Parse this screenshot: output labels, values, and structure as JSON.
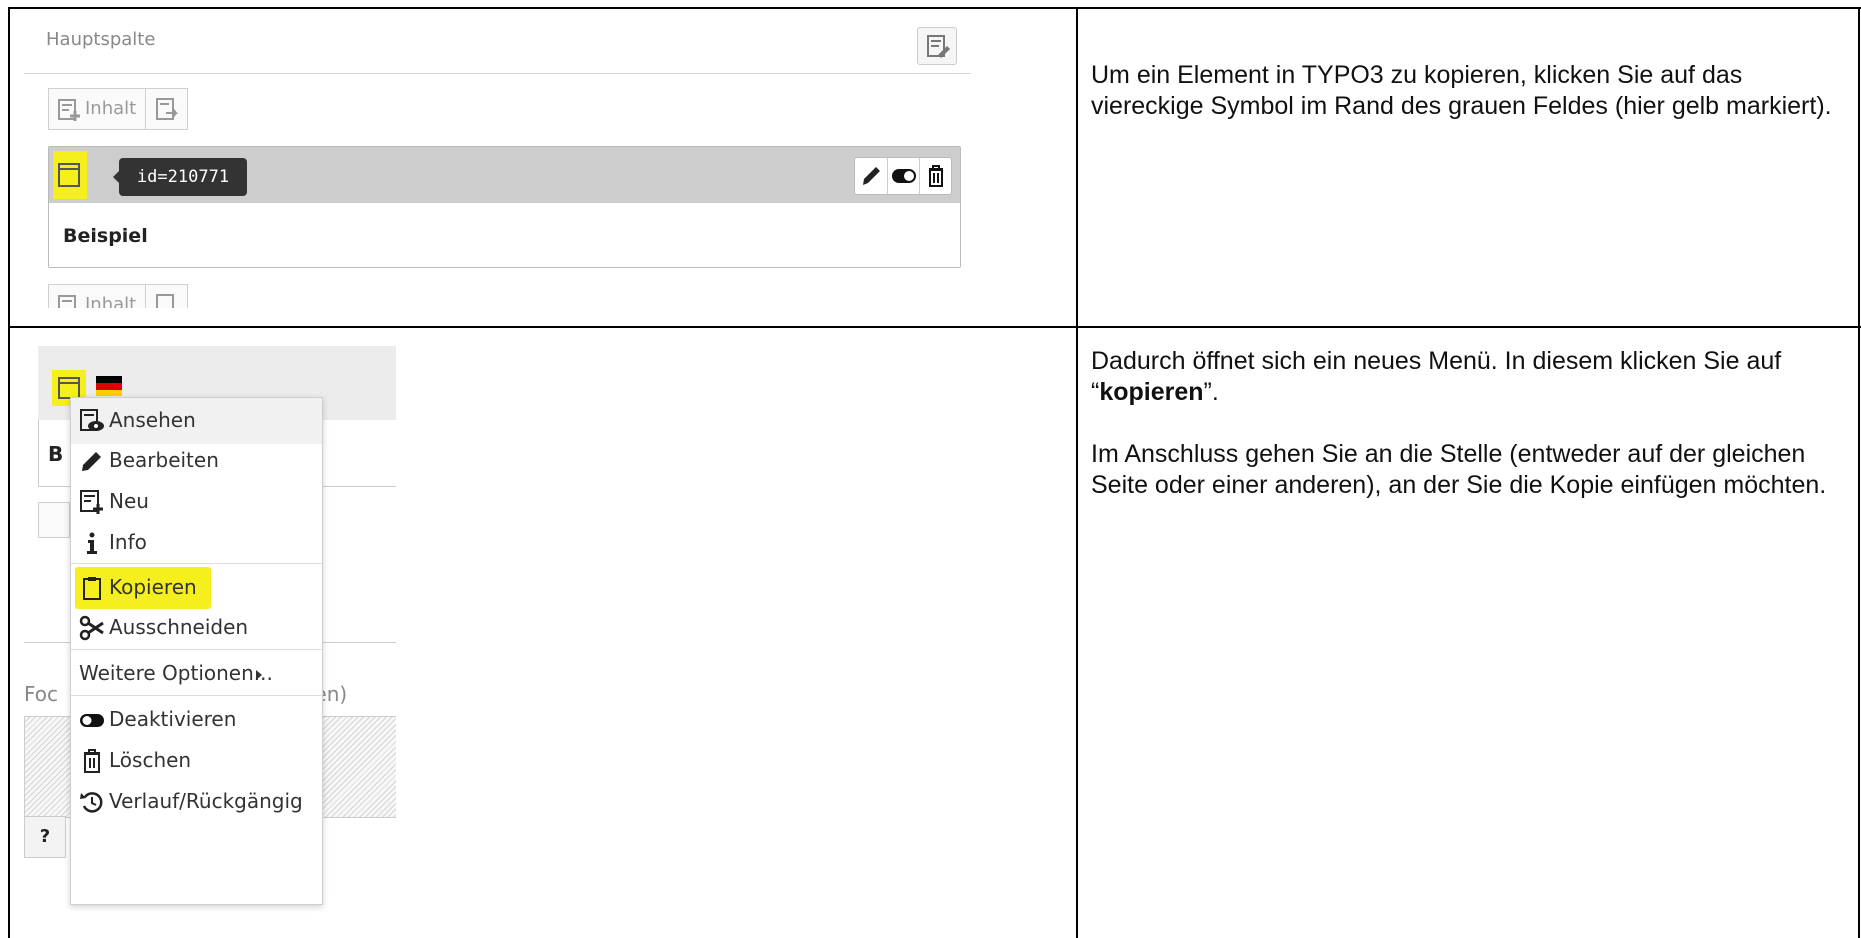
{
  "rows": [
    {
      "screenshot": {
        "column_title": "Hauptspalte",
        "new_content_label": "Inhalt",
        "element_id_tooltip": "id=210771",
        "element_title": "Beispiel",
        "highlight_color": "#f5ef1d"
      },
      "paragraphs": [
        "Um ein Element in TYPO3 zu kopieren, klicken Sie auf das viereckige Symbol im Rand des grauen Feldes (hier gelb markiert)."
      ]
    },
    {
      "screenshot": {
        "fragments": {
          "b": "B",
          "foc": "Foc",
          "sen": "sen)",
          "help": "?"
        },
        "menu": [
          {
            "label": "Ansehen",
            "icon": "view-page-icon"
          },
          {
            "label": "Bearbeiten",
            "icon": "pencil-icon"
          },
          {
            "label": "Neu",
            "icon": "new-content-icon"
          },
          {
            "label": "Info",
            "icon": "info-icon"
          },
          {
            "label": "Kopieren",
            "icon": "clipboard-icon",
            "highlighted": true
          },
          {
            "label": "Ausschneiden",
            "icon": "scissors-icon"
          },
          {
            "label": "Weitere Optionen...",
            "icon": "caret-right-icon"
          },
          {
            "label": "Deaktivieren",
            "icon": "toggle-icon"
          },
          {
            "label": "Löschen",
            "icon": "trash-icon"
          },
          {
            "label": "Verlauf/Rückgängig",
            "icon": "history-icon"
          }
        ]
      },
      "paragraph1": {
        "before": "Dadurch öffnet sich ein neues Menü. In diesem klicken Sie auf “",
        "bold": "kopieren",
        "after": "”."
      },
      "paragraph2": "Im Anschluss gehen Sie an die Stelle (entweder auf der gleichen Seite oder einer anderen), an der Sie die Kopie einfügen möchten."
    }
  ]
}
